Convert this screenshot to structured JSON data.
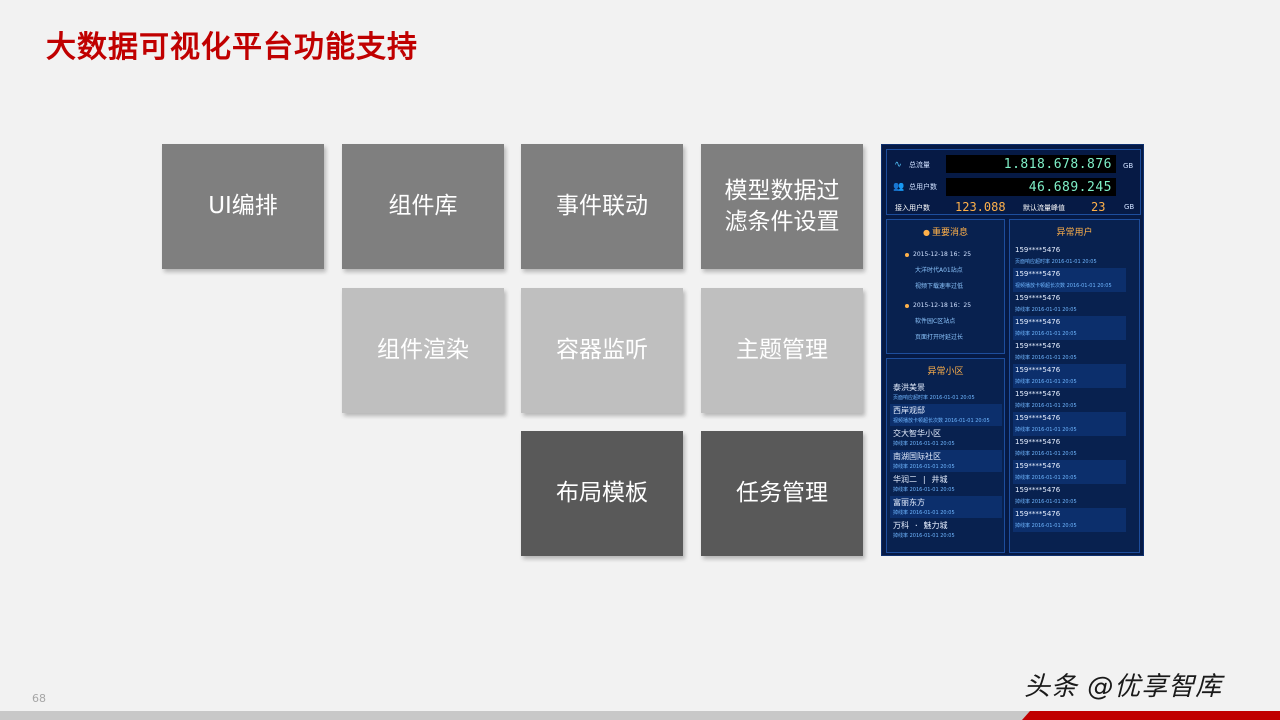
{
  "title": "大数据可视化平台功能支持",
  "tiles": [
    "UI编排",
    "组件库",
    "事件联动",
    "模型数据过滤条件设置",
    "组件渲染",
    "容器监听",
    "主题管理",
    "布局模板",
    "任务管理"
  ],
  "dashboard": {
    "total_traffic_label": "总流量",
    "total_traffic_value": "1.818.678.876",
    "total_traffic_unit": "GB",
    "total_users_label": "总用户数",
    "total_users_value": "46.689.245",
    "online_users_label": "接入用户数",
    "online_users_value": "123.088",
    "default_limit_label": "默认流量峰值",
    "default_limit_value": "23",
    "default_limit_unit": "GB",
    "messages_title": "重要消息",
    "messages": [
      {
        "date": "2015-12-18  16：25",
        "lines": [
          "大洋时代A01站点",
          "视频下载速率过低"
        ]
      },
      {
        "date": "2015-12-18  16：25",
        "lines": [
          "软件园C区站点",
          "页面打开时延过长"
        ]
      }
    ],
    "areas_title": "异常小区",
    "areas": [
      {
        "name": "泰洪美景",
        "detail": "页面响应超时率    2016-01-01  20:05"
      },
      {
        "name": "西岸观邸",
        "detail": "视频播放卡顿超长次数    2016-01-01  20:05"
      },
      {
        "name": "交大智华小区",
        "detail": "掉线率    2016-01-01  20:05"
      },
      {
        "name": "南湖国际社区",
        "detail": "掉线率    2016-01-01  20:05"
      },
      {
        "name": "华润二 | 井城",
        "detail": "掉线率    2016-01-01  20:05"
      },
      {
        "name": "富丽东方",
        "detail": "掉线率    2016-01-01  20:05"
      },
      {
        "name": "万科 · 魅力城",
        "detail": "掉线率    2016-01-01  20:05"
      }
    ],
    "users_title": "异常用户",
    "users": [
      {
        "phone": "159****5476",
        "detail": "页面响应超时率    2016-01-01  20:05"
      },
      {
        "phone": "159****5476",
        "detail": "视频播放卡顿超长次数    2016-01-01  20:05"
      },
      {
        "phone": "159****5476",
        "detail": "掉线率    2016-01-01  20:05"
      },
      {
        "phone": "159****5476",
        "detail": "掉线率    2016-01-01  20:05"
      },
      {
        "phone": "159****5476",
        "detail": "掉线率    2016-01-01  20:05"
      },
      {
        "phone": "159****5476",
        "detail": "掉线率    2016-01-01  20:05"
      },
      {
        "phone": "159****5476",
        "detail": "掉线率    2016-01-01  20:05"
      },
      {
        "phone": "159****5476",
        "detail": "掉线率    2016-01-01  20:05"
      },
      {
        "phone": "159****5476",
        "detail": "掉线率    2016-01-01  20:05"
      },
      {
        "phone": "159****5476",
        "detail": "掉线率    2016-01-01  20:05"
      },
      {
        "phone": "159****5476",
        "detail": "掉线率    2016-01-01  20:05"
      },
      {
        "phone": "159****5476",
        "detail": "掉线率    2016-01-01  20:05"
      }
    ]
  },
  "page_number": "68",
  "watermark": "头条 @优享智库",
  "colors": {
    "title": "#c00000",
    "tile_mid": "#7f7f7f",
    "tile_light": "#bfbfbf",
    "tile_dark": "#595959",
    "dashboard_bg": "#061a45"
  }
}
